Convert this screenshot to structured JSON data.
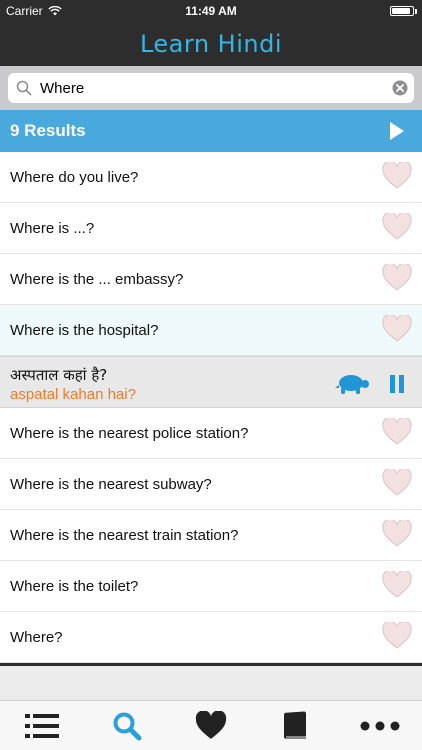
{
  "status": {
    "carrier": "Carrier",
    "time": "11:49 AM",
    "battery_level": 0.9
  },
  "app": {
    "title": "Learn Hindi"
  },
  "search": {
    "value": "Where",
    "placeholder": ""
  },
  "results": {
    "label": "9 Results"
  },
  "phrases": [
    "Where do you live?",
    "Where is ...?",
    "Where is the ... embassy?",
    "Where is the hospital?"
  ],
  "expanded": {
    "native": "अस्पताल कहां है?",
    "transliteration": "aspatal kahan hai?"
  },
  "phrases_after": [
    "Where is the nearest police station?",
    "Where is the nearest subway?",
    "Where is the nearest train station?",
    "Where is the toilet?",
    "Where?"
  ],
  "colors": {
    "accent": "#33b5e5",
    "results_bar": "#4aa9dc",
    "transliteration": "#f07a2a",
    "heart": "#f0dada"
  },
  "tabs": [
    {
      "icon": "list-icon",
      "active": false
    },
    {
      "icon": "search-icon",
      "active": true
    },
    {
      "icon": "heart-icon",
      "active": false
    },
    {
      "icon": "book-icon",
      "active": false
    },
    {
      "icon": "more-icon",
      "active": false
    }
  ]
}
